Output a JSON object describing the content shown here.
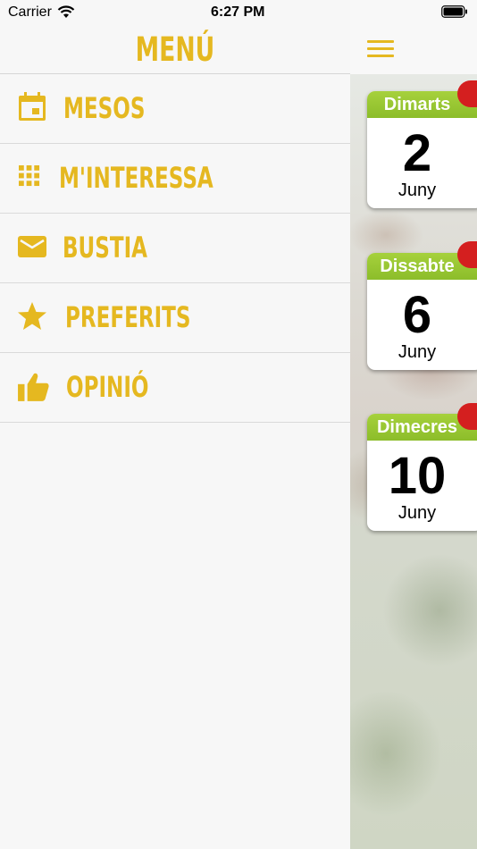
{
  "status_bar": {
    "carrier": "Carrier",
    "time": "6:27 PM"
  },
  "menu": {
    "title": "MENÚ",
    "items": [
      {
        "label": "MESOS",
        "icon": "calendar-icon"
      },
      {
        "label": "M'INTERESSA",
        "icon": "grid-icon"
      },
      {
        "label": "BUSTIA",
        "icon": "mail-icon"
      },
      {
        "label": "PREFERITS",
        "icon": "star-icon"
      },
      {
        "label": "OPINIÓ",
        "icon": "thumbs-up-icon"
      }
    ]
  },
  "main": {
    "days": [
      {
        "weekday": "Dimarts",
        "day": "2",
        "month": "Juny"
      },
      {
        "weekday": "Dissabte",
        "day": "6",
        "month": "Juny"
      },
      {
        "weekday": "Dimecres",
        "day": "10",
        "month": "Juny"
      }
    ]
  },
  "colors": {
    "accent": "#e5b820",
    "weekday_header": "#9bc933",
    "badge": "#d41f1f"
  }
}
